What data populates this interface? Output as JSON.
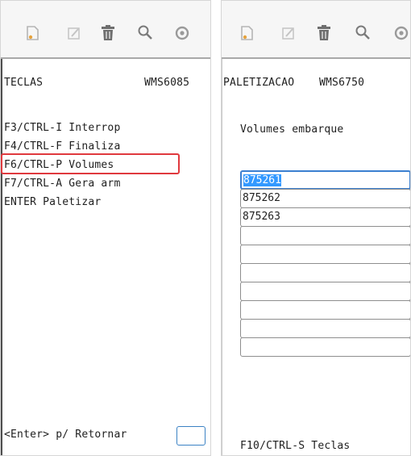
{
  "left_screen": {
    "toolbar": {
      "icons": [
        "new-document-icon",
        "edit-icon",
        "trash-icon",
        "search-icon",
        "circle-icon"
      ]
    },
    "title": "TECLAS",
    "program_code": "WMS6085",
    "keys": [
      "F3/CTRL-I Interrop",
      "F4/CTRL-F Finaliza",
      "F6/CTRL-P Volumes",
      "F7/CTRL-A Gera arm",
      "ENTER Paletizar"
    ],
    "highlighted_key_index": 2,
    "return_label": "<Enter> p/ Retornar",
    "return_input_value": ""
  },
  "right_screen": {
    "toolbar": {
      "icons": [
        "new-document-icon",
        "edit-icon",
        "trash-icon",
        "search-icon",
        "circle-icon"
      ]
    },
    "title": "PALETIZACAO",
    "program_code": "WMS6750",
    "subtitle": "Volumes embarque",
    "volumes": [
      "875261",
      "875262",
      "875263",
      "",
      "",
      "",
      "",
      "",
      "",
      ""
    ],
    "selected_volume_index": 0,
    "footer": "F10/CTRL-S Teclas"
  },
  "colors": {
    "highlight_border": "#e0393e",
    "selection_background": "#3399ff",
    "focus_border": "#3b7fd0"
  }
}
